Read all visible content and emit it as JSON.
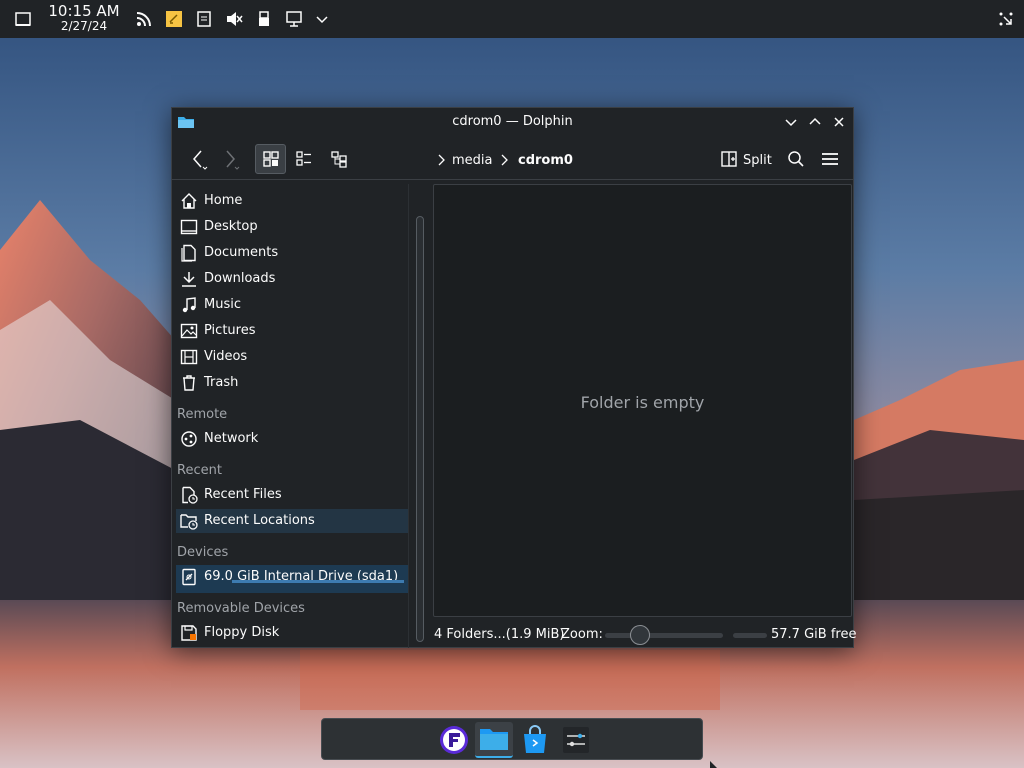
{
  "top_panel": {
    "time": "10:15 AM",
    "date": "2/27/24",
    "icons": [
      "show-desktop-icon",
      "rss-icon",
      "notes-icon",
      "clipboard-icon",
      "volume-muted-icon",
      "usb-icon",
      "network-icon",
      "expand-tray-icon",
      "settings-icon"
    ]
  },
  "window": {
    "title": "cdrom0 — Dolphin",
    "breadcrumb": [
      "media",
      "cdrom0"
    ],
    "split_label": "Split"
  },
  "places": {
    "items": [
      {
        "label": "Home",
        "icon": "home-icon"
      },
      {
        "label": "Desktop",
        "icon": "desktop-icon"
      },
      {
        "label": "Documents",
        "icon": "documents-icon"
      },
      {
        "label": "Downloads",
        "icon": "downloads-icon"
      },
      {
        "label": "Music",
        "icon": "music-icon"
      },
      {
        "label": "Pictures",
        "icon": "pictures-icon"
      },
      {
        "label": "Videos",
        "icon": "videos-icon"
      },
      {
        "label": "Trash",
        "icon": "trash-icon"
      }
    ],
    "remote_header": "Remote",
    "remote_items": [
      {
        "label": "Network",
        "icon": "network-icon"
      }
    ],
    "recent_header": "Recent",
    "recent_items": [
      {
        "label": "Recent Files",
        "icon": "recent-files-icon"
      },
      {
        "label": "Recent Locations",
        "icon": "recent-locations-icon"
      }
    ],
    "devices_header": "Devices",
    "device_items": [
      {
        "label": "69.0 GiB Internal Drive (sda1)",
        "icon": "drive-icon"
      }
    ],
    "removable_header": "Removable Devices",
    "removable_items": [
      {
        "label": "Floppy Disk",
        "icon": "floppy-icon"
      }
    ]
  },
  "view": {
    "empty_message": "Folder is empty"
  },
  "statusbar": {
    "summary": "4 Folders...(1.9 MiB)",
    "zoom_label": "Zoom:",
    "free_space": "57.7 GiB free"
  },
  "colors": {
    "accent": "#3daee9",
    "window_bg": "#202326",
    "view_bg": "#1b1e20",
    "selection": "#1d3a52"
  }
}
